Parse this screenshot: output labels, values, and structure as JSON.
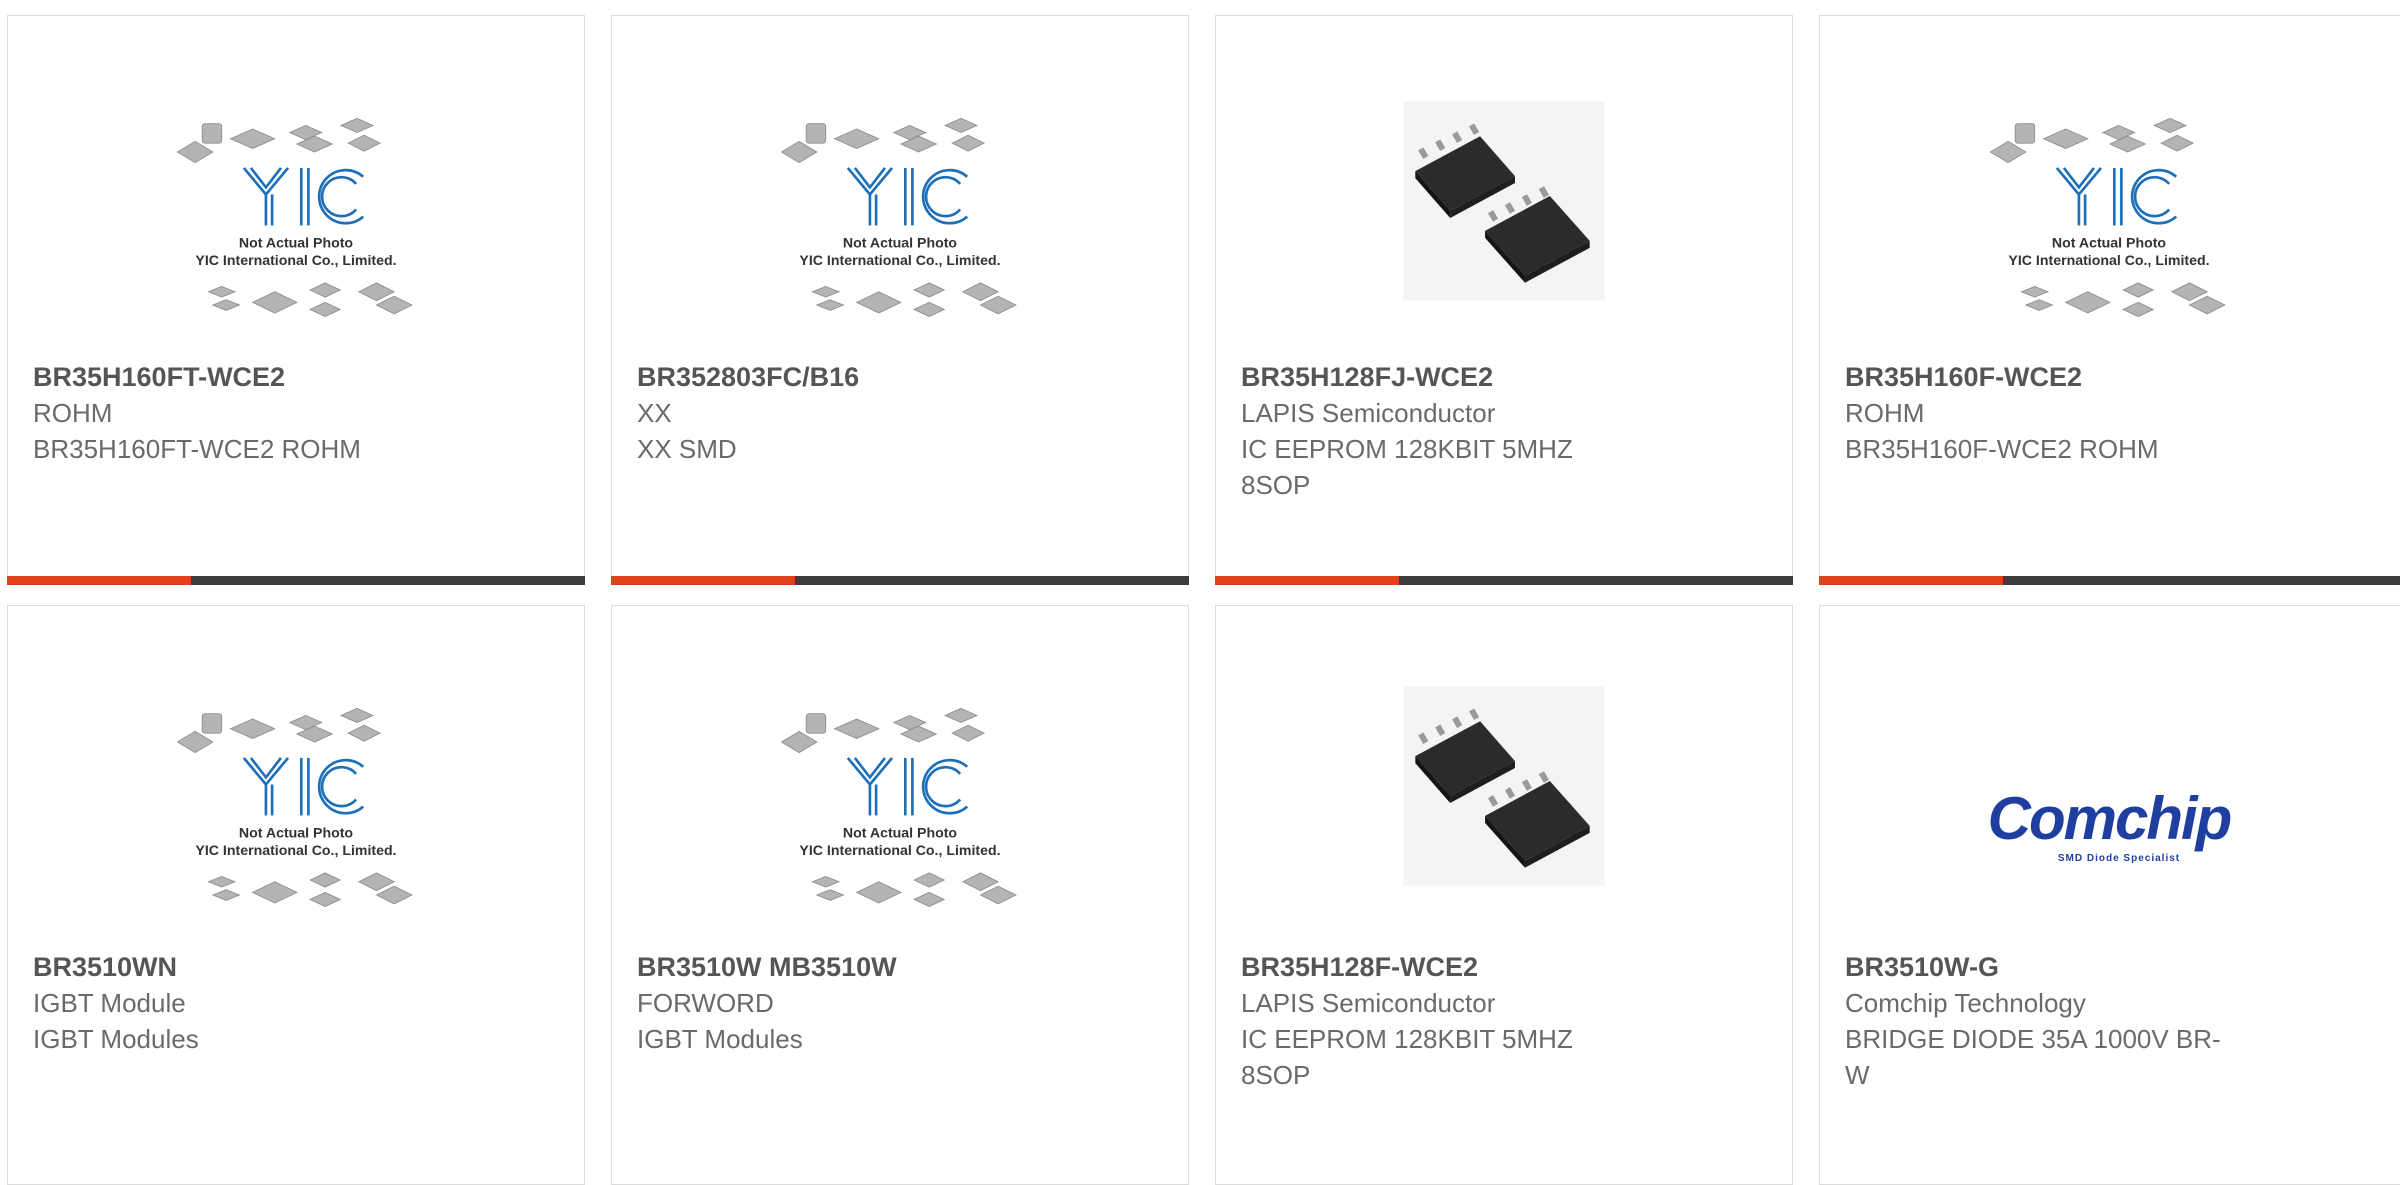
{
  "products": [
    {
      "part": "BR35H160FT-WCE2",
      "maker": "ROHM",
      "description": "BR35H160FT-WCE2 ROHM",
      "image": "placeholder-icon",
      "placeholder_line1": "Not Actual Photo",
      "placeholder_line2": "YIC International Co., Limited."
    },
    {
      "part": "BR352803FC/B16",
      "maker": "XX",
      "description": "XX SMD",
      "image": "placeholder-icon",
      "placeholder_line1": "Not Actual Photo",
      "placeholder_line2": "YIC International Co., Limited."
    },
    {
      "part": "BR35H128FJ-WCE2",
      "maker": "LAPIS Semiconductor",
      "description": "IC EEPROM 128KBIT 5MHZ 8SOP",
      "image": "chip-photo-icon"
    },
    {
      "part": "BR35H160F-WCE2",
      "maker": "ROHM",
      "description": "BR35H160F-WCE2 ROHM",
      "image": "placeholder-icon",
      "placeholder_line1": "Not Actual Photo",
      "placeholder_line2": "YIC International Co., Limited."
    },
    {
      "part": "BR3510WN",
      "maker": "IGBT Module",
      "description": "IGBT Modules",
      "image": "placeholder-icon",
      "placeholder_line1": "Not Actual Photo",
      "placeholder_line2": "YIC International Co., Limited."
    },
    {
      "part": "BR3510W MB3510W",
      "maker": "FORWORD",
      "description": "IGBT Modules",
      "image": "placeholder-icon",
      "placeholder_line1": "Not Actual Photo",
      "placeholder_line2": "YIC International Co., Limited."
    },
    {
      "part": "BR35H128F-WCE2",
      "maker": "LAPIS Semiconductor",
      "description": "IC EEPROM 128KBIT 5MHZ 8SOP",
      "image": "chip-photo-icon"
    },
    {
      "part": "BR3510W-G",
      "maker": "Comchip Technology",
      "description": "BRIDGE DIODE 35A 1000V BR-W",
      "image": "comchip-logo",
      "logo_text": "Comchip",
      "logo_tagline": "SMD Diode Specialist"
    }
  ],
  "colors": {
    "accent": "#e2401c",
    "bar": "#3c3c3c",
    "placeholder_blue": "#1d6fb8",
    "comchip_blue": "#1e3fa0"
  }
}
